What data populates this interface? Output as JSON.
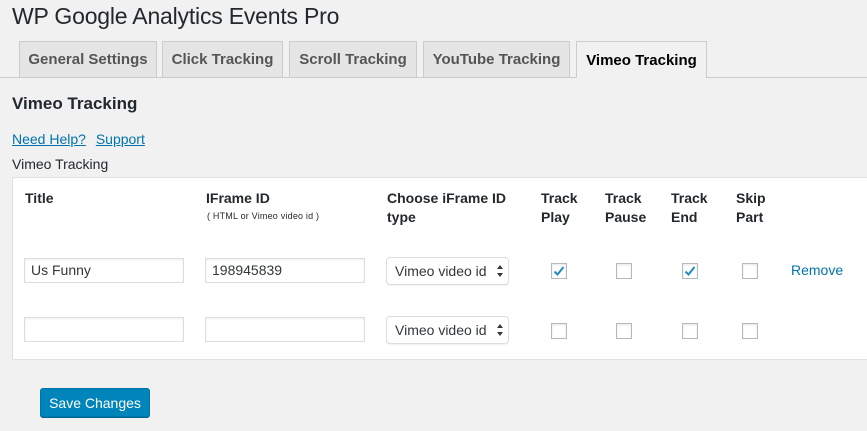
{
  "page_title": "WP Google Analytics Events Pro",
  "tabs": [
    {
      "label": "General Settings",
      "active": false
    },
    {
      "label": "Click Tracking",
      "active": false
    },
    {
      "label": "Scroll Tracking",
      "active": false
    },
    {
      "label": "YouTube Tracking",
      "active": false
    },
    {
      "label": "Vimeo Tracking",
      "active": true
    }
  ],
  "section_title": "Vimeo Tracking",
  "links": {
    "need_help": "Need Help?",
    "support": "Support"
  },
  "table_caption": "Vimeo Tracking",
  "columns": {
    "title": "Title",
    "iframe_id": "IFrame ID",
    "iframe_id_hint": "( HTML or Vimeo video id )",
    "type_line1": "Choose iFrame ID",
    "type_line2": "type",
    "play_line1": "Track",
    "play_line2": "Play",
    "pause_line1": "Track",
    "pause_line2": "Pause",
    "end_line1": "Track",
    "end_line2": "End",
    "skip_line1": "Skip",
    "skip_line2": "Part"
  },
  "rows": [
    {
      "title": "Us Funny",
      "iframe_id": "198945839",
      "type": "Vimeo video id",
      "track_play": true,
      "track_pause": false,
      "track_end": true,
      "skip_part": false,
      "remove_label": "Remove"
    },
    {
      "title": "",
      "iframe_id": "",
      "type": "Vimeo video id",
      "track_play": false,
      "track_pause": false,
      "track_end": false,
      "skip_part": false
    }
  ],
  "save_button": "Save Changes",
  "colors": {
    "accent": "#0085ba",
    "link": "#0073aa",
    "check": "#1e8cbe"
  }
}
